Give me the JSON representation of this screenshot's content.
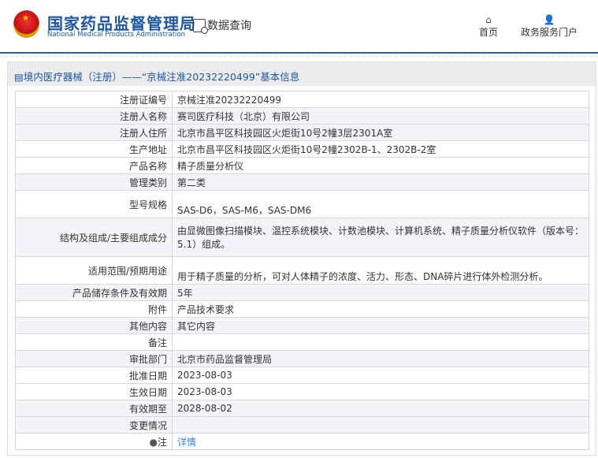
{
  "header": {
    "logo_cn": "国家药品监督管理局",
    "logo_en": "National Medical Products Administration",
    "data_query": "数据查询",
    "nav": [
      {
        "label": "首页",
        "icon": "home-icon"
      },
      {
        "label": "政务服务门户",
        "icon": "user-icon"
      }
    ]
  },
  "panel": {
    "title": "境内医疗器械（注册）——“京械注准20232220499”基本信息"
  },
  "rows": [
    {
      "label": "注册证编号",
      "value": "京械注准20232220499"
    },
    {
      "label": "注册人名称",
      "value": "赛司医疗科技（北京）有限公司"
    },
    {
      "label": "注册人住所",
      "value": "北京市昌平区科技园区火炬街10号2幢3层2301A室"
    },
    {
      "label": "生产地址",
      "value": "北京市昌平区科技园区火炬街10号2幢2302B-1、2302B-2室"
    },
    {
      "label": "产品名称",
      "value": "精子质量分析仪"
    },
    {
      "label": "管理类别",
      "value": "第二类"
    },
    {
      "label": "型号规格",
      "value": "SAS-D6，SAS-M6，SAS-DM6"
    },
    {
      "label": "结构及组成/主要组成成分",
      "value": "由显微图像扫描模块、温控系统模块、计数池模块、计算机系统、精子质量分析仪软件（版本号：5.1）组成。"
    },
    {
      "label": "适用范围/预期用途",
      "value": "用于精子质量的分析，可对人体精子的浓度、活力、形态、DNA碎片进行体外检测分析。"
    },
    {
      "label": "产品储存条件及有效期",
      "value": "5年"
    },
    {
      "label": "附件",
      "value": "产品技术要求"
    },
    {
      "label": "其他内容",
      "value": "其它内容"
    },
    {
      "label": "备注",
      "value": ""
    },
    {
      "label": "审批部门",
      "value": "北京市药品监督管理局"
    },
    {
      "label": "批准日期",
      "value": "2023-08-03"
    },
    {
      "label": "生效日期",
      "value": "2023-08-03"
    },
    {
      "label": "有效期至",
      "value": "2028-08-02"
    },
    {
      "label": "变更情况",
      "value": ""
    },
    {
      "label": "注",
      "value": "详情"
    }
  ]
}
